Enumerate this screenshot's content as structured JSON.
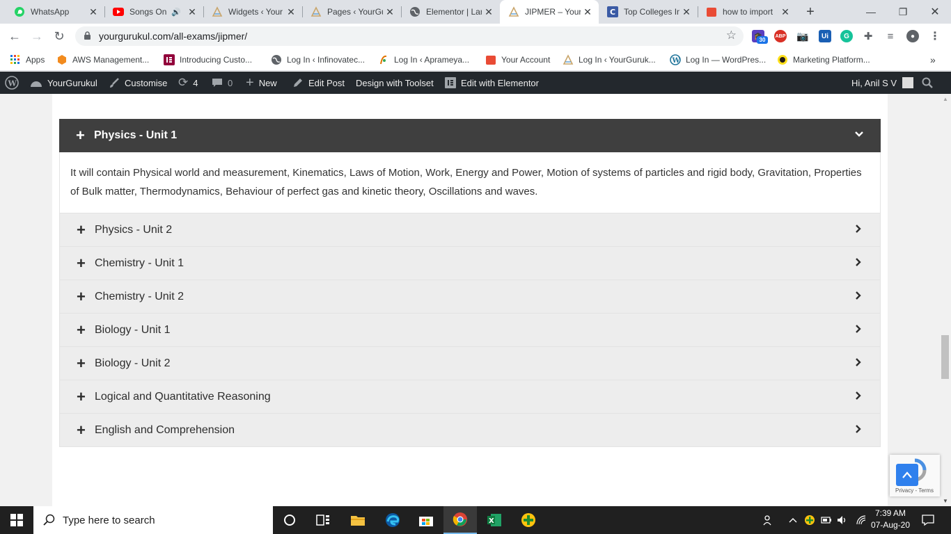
{
  "browser": {
    "tabs": [
      {
        "title": "WhatsApp",
        "icon": "whatsapp-icon",
        "active": false
      },
      {
        "title": "Songs On",
        "icon": "youtube-icon",
        "active": false
      },
      {
        "title": "Widgets ‹ Your",
        "icon": "yourgurukul-icon",
        "active": false
      },
      {
        "title": "Pages ‹ YourGu",
        "icon": "yourgurukul-icon",
        "active": false
      },
      {
        "title": "Elementor | Lan",
        "icon": "globe-icon",
        "active": false
      },
      {
        "title": "JIPMER – Your",
        "icon": "yourgurukul-icon",
        "active": true
      },
      {
        "title": "Top Colleges In",
        "icon": "c-icon",
        "active": false
      },
      {
        "title": "how to import",
        "icon": "bookmark-red-icon",
        "active": false
      }
    ],
    "url": "yourgurukul.com/all-exams/jipmer/",
    "extension_badge": "30",
    "bookmarks": [
      {
        "label": "Apps",
        "icon": "apps-grid-icon"
      },
      {
        "label": "AWS Management...",
        "icon": "aws-icon"
      },
      {
        "label": "Introducing Custo...",
        "icon": "elementor-icon"
      },
      {
        "label": "Log In ‹ Infinovatec...",
        "icon": "globe-icon"
      },
      {
        "label": "Log In ‹ Aprameya...",
        "icon": "aprameya-icon"
      },
      {
        "label": "Your Account",
        "icon": "account-icon"
      },
      {
        "label": "Log In ‹ YourGuruk...",
        "icon": "yourgurukul-icon"
      },
      {
        "label": "Log In — WordPres...",
        "icon": "wordpress-icon"
      },
      {
        "label": "Marketing Platform...",
        "icon": "mailchimp-icon"
      }
    ]
  },
  "adminbar": {
    "site_name": "YourGurukul",
    "customise": "Customise",
    "updates_count": "4",
    "comments_count": "0",
    "new": "New",
    "edit_post": "Edit Post",
    "toolset": "Design with Toolset",
    "elementor": "Edit with Elementor",
    "greeting": "Hi, Anil S V"
  },
  "accordion": {
    "open_item": {
      "title": "Physics - Unit 1",
      "content": "It will contain Physical world and measurement, Kinematics, Laws of Motion, Work, Energy and Power, Motion of systems of particles and rigid body, Gravitation, Properties of Bulk matter, Thermodynamics, Behaviour of perfect gas and kinetic theory, Oscillations and waves."
    },
    "items": [
      "Physics - Unit 2",
      "Chemistry - Unit 1",
      "Chemistry - Unit 2",
      "Biology - Unit 1",
      "Biology - Unit 2",
      "Logical and Quantitative Reasoning",
      "English and Comprehension"
    ]
  },
  "recaptcha": {
    "links": "Privacy - Terms"
  },
  "taskbar": {
    "search_placeholder": "Type here to search",
    "time": "7:39 AM",
    "date": "07-Aug-20"
  }
}
